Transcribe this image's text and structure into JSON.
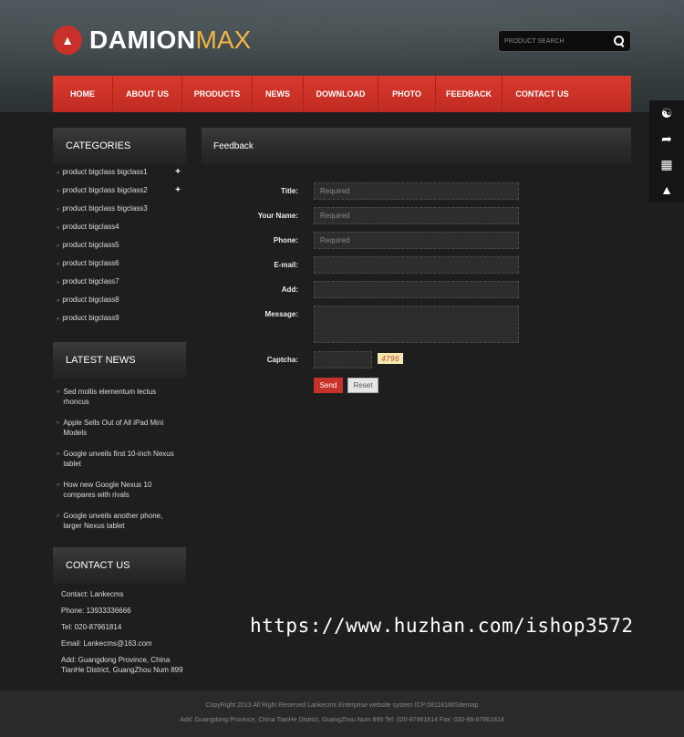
{
  "header": {
    "logo_main": "DAMION",
    "logo_accent": "MAX",
    "search_placeholder": "PRODUCT SEARCH"
  },
  "nav": {
    "items": [
      {
        "label": "HOME"
      },
      {
        "label": "ABOUT US"
      },
      {
        "label": "PRODUCTS"
      },
      {
        "label": "NEWS"
      },
      {
        "label": "DOWNLOAD"
      },
      {
        "label": "PHOTO"
      },
      {
        "label": "FEEDBACK"
      },
      {
        "label": "CONTACT US"
      }
    ]
  },
  "floatbar": {
    "icons": [
      "headset-icon",
      "share-icon",
      "qrcode-icon",
      "rocket-icon"
    ]
  },
  "categories": {
    "title": "CATEGORIES",
    "items": [
      {
        "label": "product bigclass bigclass1",
        "expand": "+"
      },
      {
        "label": "product bigclass bigclass2",
        "expand": "+"
      },
      {
        "label": "product bigclass bigclass3",
        "expand": ""
      },
      {
        "label": "product bigclass4",
        "expand": ""
      },
      {
        "label": "product bigclass5",
        "expand": ""
      },
      {
        "label": "product bigclass6",
        "expand": ""
      },
      {
        "label": "product bigclass7",
        "expand": ""
      },
      {
        "label": "product bigclass8",
        "expand": ""
      },
      {
        "label": "product bigclass9",
        "expand": ""
      }
    ]
  },
  "latest_news": {
    "title": "LATEST NEWS",
    "items": [
      "Sed mollis elementum lectus rhoncus",
      "Apple Sells Out of All iPad Mini Models",
      "Google unveils first 10-inch Nexus tablet",
      "How new Google Nexus 10 compares with rivals",
      "Google unveils another phone, larger Nexus tablet"
    ]
  },
  "contact": {
    "title": "CONTACT US",
    "lines": [
      "Contact: Lankecms",
      "Phone: 13933336666",
      "Tel: 020-87961814",
      "Email: Lankecms@163.com",
      "Add: Guangdong Province, China TianHe District, GuangZhou Num 899"
    ]
  },
  "feedback": {
    "title": "Feedback",
    "fields": {
      "title_label": "Title:",
      "title_placeholder": "Required",
      "name_label": "Your Name:",
      "name_placeholder": "Required",
      "phone_label": "Phone:",
      "phone_placeholder": "Required",
      "email_label": "E-mail:",
      "add_label": "Add:",
      "message_label": "Message:",
      "captcha_label": "Captcha:",
      "captcha_code": "4796"
    },
    "send_label": "Send",
    "reset_label": "Reset"
  },
  "watermark": "https://www.huzhan.com/ishop3572",
  "footer": {
    "line1": "CopyRight 2013 All Right Reserved Lankecms Enterprise website system ICP:08118166Sitemap",
    "line2": "Add: Guangdong Province, China TianHe District, GuangZhou Num 899  Tel: 020-87961814  Fax: 020-98-87961814"
  },
  "colors": {
    "accent_red": "#c9322a",
    "logo_accent": "#f2b544",
    "background": "#1e1e1e"
  }
}
